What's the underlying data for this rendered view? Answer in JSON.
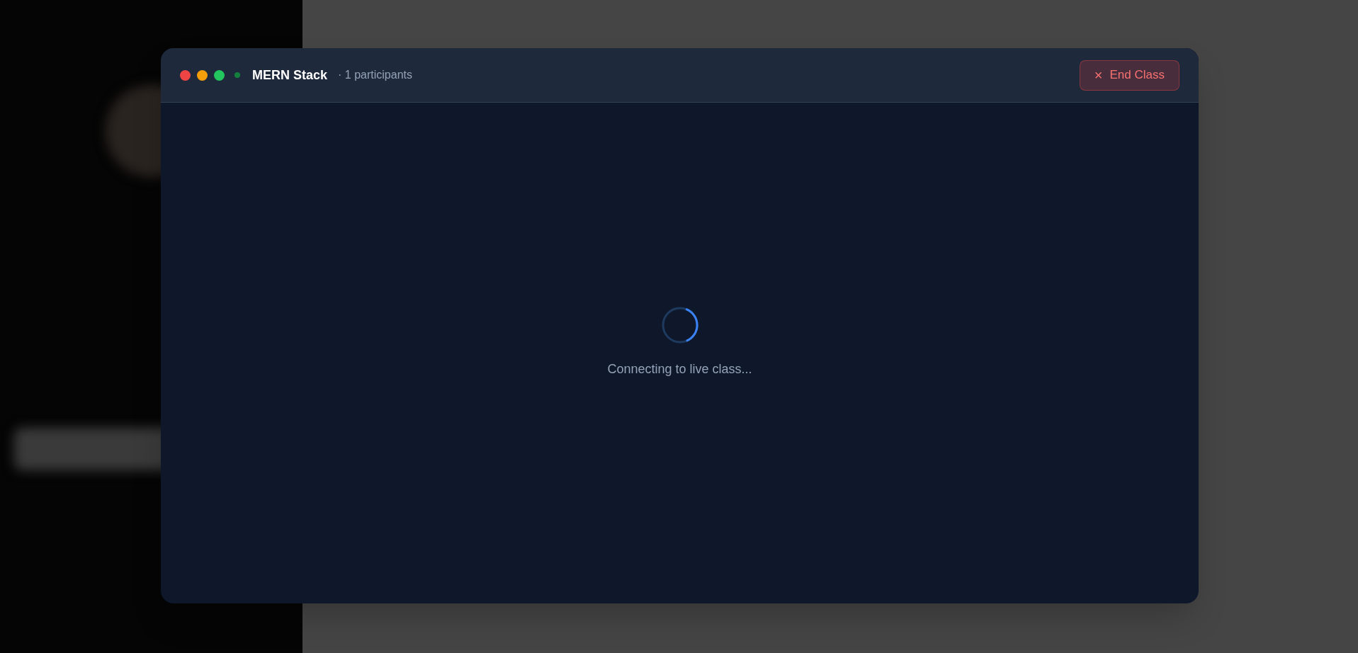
{
  "live_class": {
    "window_buttons": [
      {
        "color": "#ef4444"
      },
      {
        "color": "#f59e0b"
      },
      {
        "color": "#22c55e"
      }
    ],
    "live_indicator": {
      "color": "#15803d"
    },
    "title": "MERN Stack",
    "participants": "· 1 participants",
    "end_button": {
      "label": "End Class",
      "icon": "×"
    },
    "status": "Connecting to live class..."
  }
}
